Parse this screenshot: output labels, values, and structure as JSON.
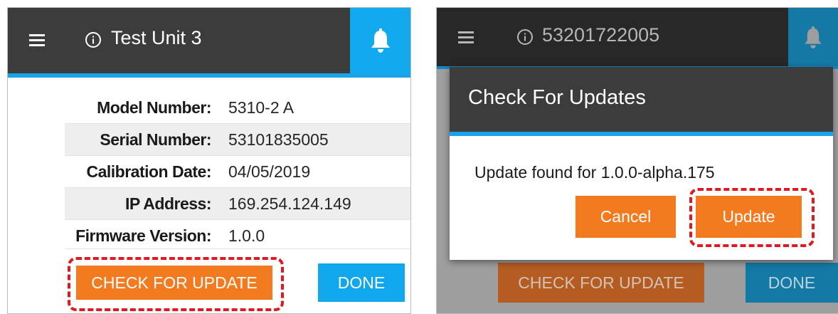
{
  "left_screen": {
    "title": "Test Unit 3",
    "icons": {
      "menu": "hamburger-menu-icon",
      "info": "info-circle-icon",
      "notifications": "bell-icon"
    },
    "info_rows": [
      {
        "label": "Model Number:",
        "value": "5310-2 A"
      },
      {
        "label": "Serial Number:",
        "value": "53101835005"
      },
      {
        "label": "Calibration Date:",
        "value": "04/05/2019"
      },
      {
        "label": "IP Address:",
        "value": "169.254.124.149"
      },
      {
        "label": "Firmware Version:",
        "value": "1.0.0"
      }
    ],
    "check_update_label": "CHECK FOR UPDATE",
    "done_label": "DONE"
  },
  "right_screen": {
    "title": "53201722005",
    "background_check_update_label": "CHECK FOR UPDATE",
    "background_done_label": "DONE",
    "dialog": {
      "title": "Check For Updates",
      "message": "Update found for 1.0.0-alpha.175",
      "cancel_label": "Cancel",
      "update_label": "Update"
    }
  },
  "colors": {
    "app_bar": "#3c3c3c",
    "accent_blue": "#1aa3e8",
    "bell_button": "#12a9ef",
    "button_orange": "#f47a20",
    "button_blue": "#11a7ec",
    "highlight_red": "#e5171e",
    "overlay_gray": "#9e9e9e"
  }
}
